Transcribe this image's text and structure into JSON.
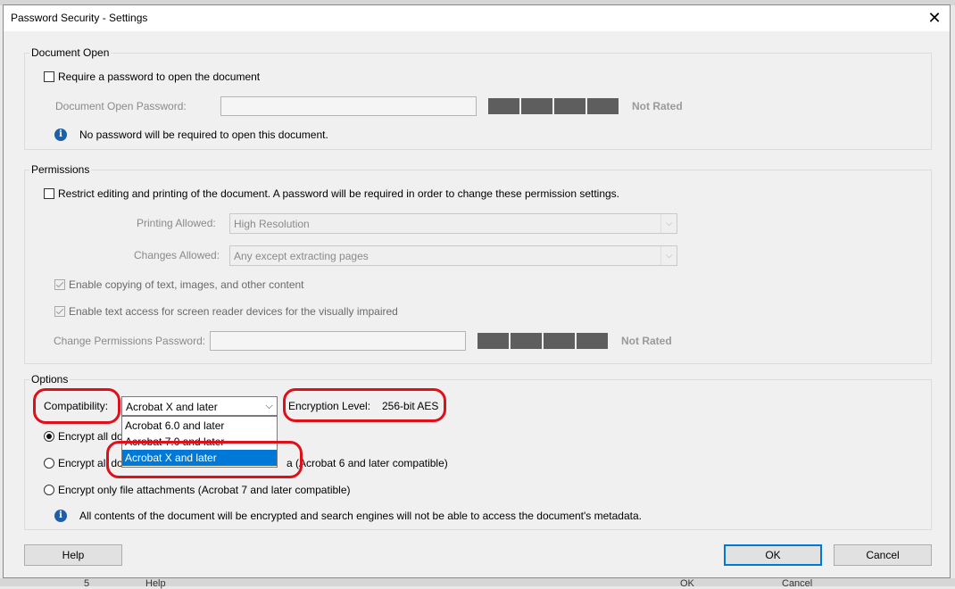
{
  "background": {
    "left_fragment": "5",
    "help_fragment": "Help",
    "ok_fragment": "OK",
    "cancel_fragment": "Cancel"
  },
  "dialog": {
    "title": "Password Security - Settings",
    "close_glyph": "✕"
  },
  "document_open": {
    "legend": "Document Open",
    "require_label": "Require a password to open the document",
    "require_checked": false,
    "password_label": "Document Open Password:",
    "password_value": "",
    "strength": "Not Rated",
    "info": "No password will be required to open this document."
  },
  "permissions": {
    "legend": "Permissions",
    "restrict_label": "Restrict editing and printing of the document. A password will be required in order to change these permission settings.",
    "restrict_checked": false,
    "printing_label": "Printing Allowed:",
    "printing_value": "High Resolution",
    "changes_label": "Changes Allowed:",
    "changes_value": "Any except extracting pages",
    "copy_label": "Enable copying of text, images, and other content",
    "copy_checked": true,
    "screenreader_label": "Enable text access for screen reader devices for the visually impaired",
    "screenreader_checked": true,
    "change_pw_label": "Change Permissions Password:",
    "change_pw_value": "",
    "strength": "Not Rated"
  },
  "options": {
    "legend": "Options",
    "compat_label": "Compatibility:",
    "compat_value": "Acrobat X and later",
    "compat_options": [
      "Acrobat 6.0 and later",
      "Acrobat 7.0 and later",
      "Acrobat X and later"
    ],
    "compat_selected": "Acrobat X and later",
    "encryption_label": "Encryption  Level:",
    "encryption_value": "256-bit AES",
    "radio_all": "Encrypt all do",
    "radio_all_except_start": "Encrypt all do",
    "radio_all_except_end": "a (Acrobat 6 and later compatible)",
    "radio_attachments": "Encrypt only file attachments (Acrobat 7 and later compatible)",
    "selected_radio": "all",
    "info": "All contents of the document will be encrypted and search engines will not be able to access the document's metadata."
  },
  "buttons": {
    "help": "Help",
    "ok": "OK",
    "cancel": "Cancel"
  },
  "colors": {
    "annotation_red": "#e0101a",
    "selection_blue": "#0078d7",
    "strength_meter": "#5e5e5e"
  }
}
